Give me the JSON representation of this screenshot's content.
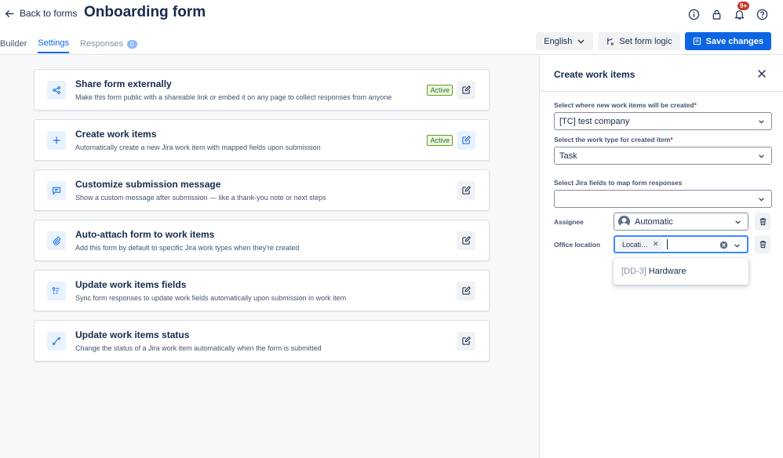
{
  "header": {
    "back_label": "Back to forms",
    "title": "Onboarding form",
    "notification_count": "9+",
    "tabs": [
      {
        "label": "Builder"
      },
      {
        "label": "Settings"
      },
      {
        "label": "Responses",
        "count": "0"
      }
    ],
    "language": "English",
    "form_logic_label": "Set form logic",
    "save_label": "Save changes"
  },
  "cards": [
    {
      "title": "Share form externally",
      "desc": "Make this form public with a shareable link or embed it on any page to collect responses from anyone",
      "status": "Active",
      "icon": "share-icon"
    },
    {
      "title": "Create work items",
      "desc": "Automatically create a new Jira work item with mapped fields upon submission",
      "status": "Active",
      "icon": "plus-icon"
    },
    {
      "title": "Customize submission message",
      "desc": "Show a custom message after submission — like a thank-you note or next steps",
      "status": "",
      "icon": "message-icon"
    },
    {
      "title": "Auto-attach form to work items",
      "desc": "Add this form by default to specific Jira work types when they're created",
      "status": "",
      "icon": "paperclip-icon"
    },
    {
      "title": "Update work items fields",
      "desc": "Sync form responses to update work fields automatically upon submission in work item",
      "status": "",
      "icon": "fields-icon"
    },
    {
      "title": "Update work items status",
      "desc": "Change the status of a Jira work item automatically when the form is submitted",
      "status": "",
      "icon": "status-icon"
    }
  ],
  "panel": {
    "title": "Create work items",
    "where_label": "Select where new work items will be created",
    "where_value": "[TC] test company",
    "type_label": "Select the work type for created item",
    "type_value": "Task",
    "map_label": "Select Jira fields to map form responses",
    "map_value": "",
    "assignee_label": "Assignee",
    "assignee_value": "Automatic",
    "office_label": "Office location",
    "office_tag": "Locati…",
    "office_option_key": "[DD-3]",
    "office_option_value": "Hardware"
  },
  "colors": {
    "accent": "#0c66e4",
    "active_status": "#216e4e",
    "required": "#c9372c"
  }
}
